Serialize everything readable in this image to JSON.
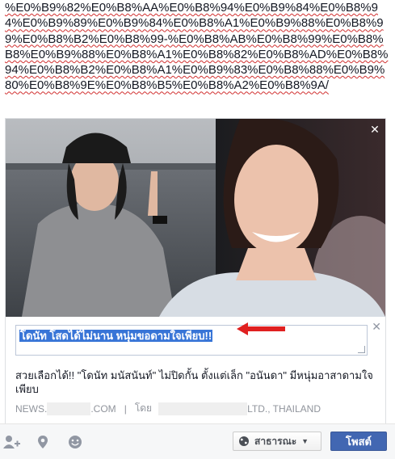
{
  "composer": {
    "text": "%E0%B9%82%E0%B8%AA%E0%B8%94%E0%B9%84%E0%B8%94%E0%B9%89%E0%B9%84%E0%B8%A1%E0%B9%88%E0%B8%99%E0%B8%B2%E0%B8%99-%E0%B8%AB%E0%B8%99%E0%B8%B8%E0%B9%88%E0%B8%A1%E0%B8%82%E0%B8%AD%E0%B8%94%E0%B8%B2%E0%B8%A1%E0%B9%83%E0%B8%88%E0%B9%80%E0%B8%9E%E0%B8%B5%E0%B8%A2%E0%B8%9A/"
  },
  "attachment": {
    "title": "โดนัท โสดได้ไม่นาน หนุ่มขอดามใจเพียบ!!",
    "description": "สวยเลือกได้!! \"โดนัท มนัสนันท์\" ไม่ปิดกั้น ตั้งแต่เล็ก \"อนันดา\" มีหนุ่มอาสาดามใจเพียบ",
    "source_domain_prefix": "NEWS.",
    "source_domain_suffix": ".COM",
    "separator": "|",
    "by_label": "โดย",
    "author_suffix": "LTD., THAILAND"
  },
  "footer": {
    "privacy_label": "สาธารณะ",
    "post_label": "โพสต์"
  },
  "icons": {
    "tag_people": "person-plus-icon",
    "location": "map-pin-icon",
    "feeling": "smiley-icon",
    "globe": "globe-icon",
    "dropdown": "caret-down-icon"
  },
  "colors": {
    "post_button": "#4267b2",
    "link_title": "#3b5998",
    "selection": "#3875d7",
    "arrow": "#e02020"
  }
}
